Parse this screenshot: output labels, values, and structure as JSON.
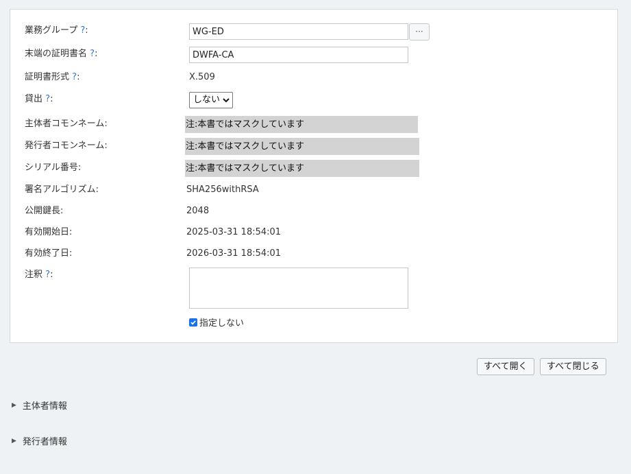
{
  "form": {
    "help_mark": "?",
    "business_group": {
      "label": "業務グループ",
      "value": "WG-ED",
      "browse_label": "···"
    },
    "end_cert_name": {
      "label": "末端の証明書名",
      "value": "DWFA-CA"
    },
    "cert_format": {
      "label": "証明書形式",
      "value": "X.509"
    },
    "lending": {
      "label": "貸出",
      "selected": "しない"
    },
    "subject_cn": {
      "label": "主体者コモンネーム:",
      "value": "注:本書ではマスクしています"
    },
    "issuer_cn": {
      "label": "発行者コモンネーム:",
      "value": "注:本書ではマスクしています"
    },
    "serial_number": {
      "label": "シリアル番号:",
      "value": "注:本書ではマスクしています"
    },
    "signature_algorithm": {
      "label": "署名アルゴリズム:",
      "value": "SHA256withRSA"
    },
    "key_length": {
      "label": "公開鍵長:",
      "value": "2048"
    },
    "valid_from": {
      "label": "有効開始日:",
      "value": "2025-03-31 18:54:01"
    },
    "valid_to": {
      "label": "有効終了日:",
      "value": "2026-03-31 18:54:01"
    },
    "notes": {
      "label": "注釈",
      "value": ""
    },
    "not_specified": {
      "label": "指定しない",
      "checked": true
    }
  },
  "actions": {
    "expand_all": "すべて開く",
    "collapse_all": "すべて閉じる"
  },
  "sections": {
    "subject_info": "主体者情報",
    "issuer_info": "発行者情報"
  },
  "colors": {
    "accent": "#1a73e8",
    "help": "#3a78c2",
    "masked_bg": "#d3d3d3",
    "page_bg": "#eff2f5"
  }
}
